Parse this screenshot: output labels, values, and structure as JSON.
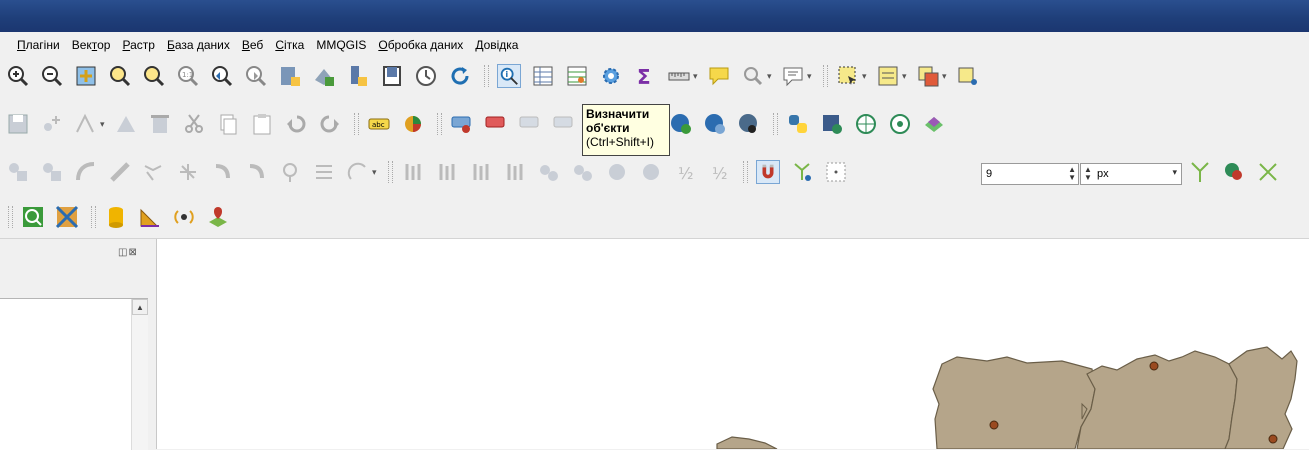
{
  "menubar": {
    "items": [
      {
        "label": "Плагіни",
        "ul": "П",
        "rest": "лагіни"
      },
      {
        "label": "Вектор",
        "ul": "",
        "rest": "Вектор"
      },
      {
        "label": "Растр",
        "ul": "Р",
        "rest": "астр"
      },
      {
        "label": "База даних",
        "ul": "Б",
        "rest": "аза даних"
      },
      {
        "label": "Веб",
        "ul": "В",
        "rest": "еб"
      },
      {
        "label": "Сітка",
        "ul": "С",
        "rest": "ітка"
      },
      {
        "label": "MMQGIS",
        "ul": "",
        "rest": "MMQGIS"
      },
      {
        "label": "Обробка даних",
        "ul": "О",
        "rest": "бробка даних"
      },
      {
        "label": "Довідка",
        "ul": "Д",
        "rest": "овідка"
      }
    ]
  },
  "tooltip": {
    "title_line1": "Визначити",
    "title_line2": "об'єкти",
    "shortcut": "(Ctrl+Shift+I)"
  },
  "snapping": {
    "tolerance_value": "9",
    "units_value": "px"
  },
  "icons": {
    "toolbar1": [
      "zoom-in-icon",
      "zoom-out-icon",
      "zoom-full-icon",
      "zoom-to-selection-icon",
      "zoom-to-layer-icon",
      "zoom-native-icon",
      "zoom-last-icon",
      "zoom-next-icon",
      "new-bookmark-icon",
      "show-bookmarks-icon",
      "map-tips-icon",
      "new-map-view-icon",
      "temporal-icon",
      "refresh-icon",
      "identify-features-icon",
      "attribute-table-icon",
      "field-calculator-icon",
      "processing-toolbox-icon",
      "statistics-sum-icon",
      "measure-line-icon",
      "annotation-icon",
      "spatial-query-icon",
      "map-canvas-menu-icon",
      "select-feature-icon",
      "select-by-value-icon",
      "deselect-icon",
      "add-point-icon"
    ],
    "toolbar2": [
      "save-edits-icon",
      "add-feature-icon",
      "digitize-icon",
      "vertex-tool-icon",
      "delete-selected-icon",
      "cut-features-icon",
      "copy-features-icon",
      "paste-features-icon",
      "undo-icon",
      "redo-icon",
      "label-tool-icon",
      "diagram-tool-icon",
      "pin-labels-icon",
      "highlight-labels-icon",
      "move-label-icon",
      "rotate-label-icon",
      "change-label-icon",
      "select-by-location-icon",
      "wms-icon",
      "wfs-icon",
      "wcs-icon",
      "python-console-icon",
      "save-as-icon",
      "network-icon",
      "globe-icon",
      "layer-stack-icon"
    ],
    "toolbar3": [
      "advanced-digitize-icon",
      "split-icon",
      "reshape-icon",
      "offset-curve-icon",
      "simplify-icon",
      "add-ring-icon",
      "add-part-icon",
      "fill-ring-icon",
      "delete-ring-icon",
      "delete-part-icon",
      "rotate-feature-icon",
      "split-parts-icon",
      "merge-icon",
      "merge-attributes-icon",
      "rotate-symbol-icon",
      "offset-symbol-icon",
      "rotate-point-icon",
      "trace-icon",
      "node-icon",
      "snapping-magnet-icon",
      "topology-icon",
      "snap-mode-icon",
      "snap-to-vertex-icon",
      "remove-snap-icon",
      "close-snap-icon"
    ],
    "toolbar4": [
      "gps-zoom-icon",
      "georeferencer-icon",
      "database-icon",
      "geometry-checker-icon",
      "gps-tracking-icon",
      "locate-point-icon"
    ]
  }
}
